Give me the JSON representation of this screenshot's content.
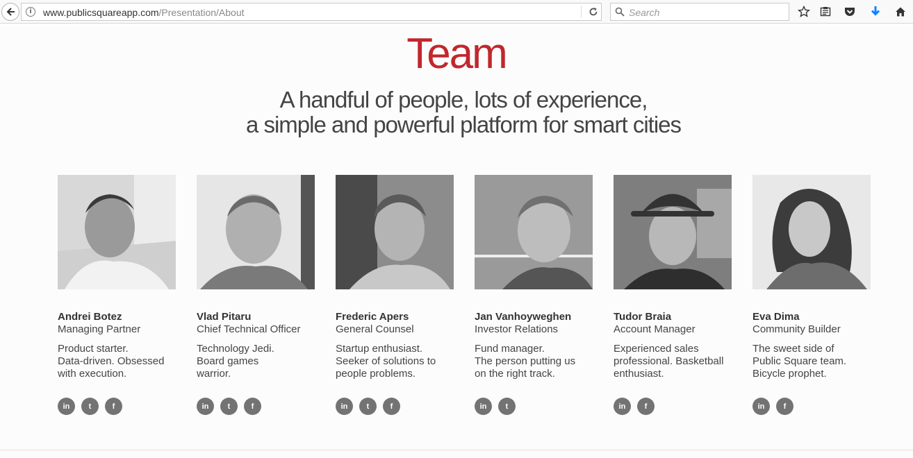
{
  "browser": {
    "url_host": "www.publicsquareapp.com",
    "url_path": "/Presentation/About",
    "search_placeholder": "Search",
    "icons": [
      "back-arrow-icon",
      "info-icon",
      "reload-icon",
      "search-icon",
      "bookmark-star-icon",
      "reader-view-icon",
      "pocket-icon",
      "download-icon",
      "home-icon"
    ],
    "accent_download": "#0a84ff"
  },
  "page": {
    "title": "Team",
    "subtitle_line1": "A handful of people, lots of experience,",
    "subtitle_line2": "a simple and powerful platform for smart cities",
    "title_color": "#c1272d"
  },
  "team": [
    {
      "name": "Andrei Botez",
      "role": "Managing Partner",
      "bio": [
        "Product starter.",
        "Data-driven. Obsessed",
        "with execution."
      ],
      "social": [
        "linkedin",
        "twitter",
        "facebook"
      ]
    },
    {
      "name": "Vlad Pitaru",
      "role": "Chief Technical Officer",
      "bio": [
        "Technology Jedi.",
        "Board games",
        "warrior."
      ],
      "social": [
        "linkedin",
        "twitter",
        "facebook"
      ]
    },
    {
      "name": "Frederic Apers",
      "role": "General Counsel",
      "bio": [
        "Startup enthusiast.",
        "Seeker of solutions to",
        "people problems."
      ],
      "social": [
        "linkedin",
        "twitter",
        "facebook"
      ]
    },
    {
      "name": "Jan Vanhoyweghen",
      "role": "Investor Relations",
      "bio": [
        "Fund manager.",
        "The person putting us",
        "on the right track."
      ],
      "social": [
        "linkedin",
        "twitter"
      ]
    },
    {
      "name": "Tudor Braia",
      "role": "Account Manager",
      "bio": [
        "Experienced sales",
        "professional. Basketball",
        "enthusiast."
      ],
      "social": [
        "linkedin",
        "facebook"
      ]
    },
    {
      "name": "Eva Dima",
      "role": "Community Builder",
      "bio": [
        "The sweet side of",
        "Public Square team.",
        "Bicycle prophet."
      ],
      "social": [
        "linkedin",
        "facebook"
      ]
    }
  ],
  "social_labels": {
    "linkedin": "in",
    "twitter": "t",
    "facebook": "f"
  },
  "social_color": "#737373"
}
